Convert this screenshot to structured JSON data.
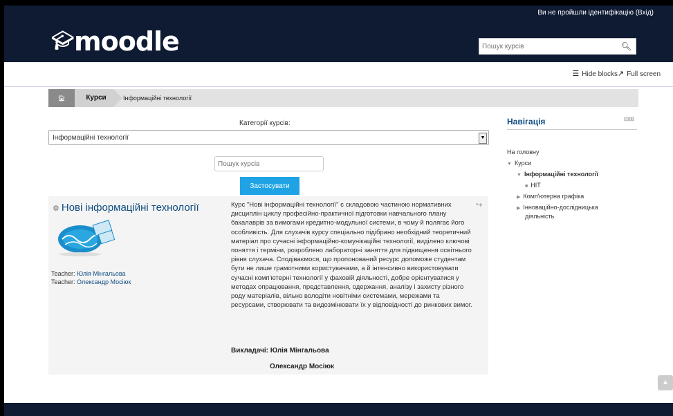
{
  "header": {
    "login_text": "Ви не пройшли ідентифікацію (Вхід)",
    "logo_text": "moodle",
    "search_placeholder": "Пошук курсів"
  },
  "toolbar": {
    "hide_blocks": "Hide blocks",
    "full_screen": "Full screen"
  },
  "breadcrumb": {
    "home_icon": "home-icon",
    "courses": "Курси",
    "current": "Інформаційні технології"
  },
  "categories": {
    "label": "Категорії курсів:",
    "selected": "Інформаційні технології",
    "search_placeholder": "Пошук курсів",
    "apply_label": "Застосувати"
  },
  "course": {
    "title": "Нові інформаційні технології",
    "teachers": [
      {
        "role": "Teacher:",
        "name": "Юлія Мінгальова"
      },
      {
        "role": "Teacher:",
        "name": "Олександр Мосіюк"
      }
    ],
    "summary": "Курс \"Нові інформаційні технології\" є складовою частиною нормативних дисциплін циклу професійно-практичної підготовки навчального плану бакалаврів за вимогами кредитно-модульної системи, в чому й полягає його особливість. Для слухачів курсу спеціально підібрано необхідний теоретичний матеріал про сучасні інформаційно-комунікаційні технології, виділено ключові поняття і терміни, розроблено лабораторні заняття для підвищення освітнього рівня слухача. Сподіваємося, що пропонований ресурс допоможе студентам бути не лише грамотними користувачами, а й інтенсивно використовувати сучасні комп'ютерні технології у фаховій діяльності, добре орієнтуватися у методах опрацювання, представлення, одержання, аналізу і захисту різного роду матеріалів, вільно володіти новітніми системами, мережами та ресурсами, створювати та видозмінювати їх у відповідності до ринкових вимог.",
    "teachers_line": "Викладачі: Юлія Мінгальова",
    "teacher2": "Олександр Мосіюк"
  },
  "navigation": {
    "title": "Навігація",
    "items": [
      "На головну",
      "Курси",
      "Інформаційні технології",
      "НІТ",
      "Комп'ютерна графіка",
      "Інноваційно-дослідницька",
      "діяльність"
    ]
  },
  "colors": {
    "header_bg": "#0f1b33",
    "accent": "#1fa3e5",
    "link": "#0f4c81"
  }
}
